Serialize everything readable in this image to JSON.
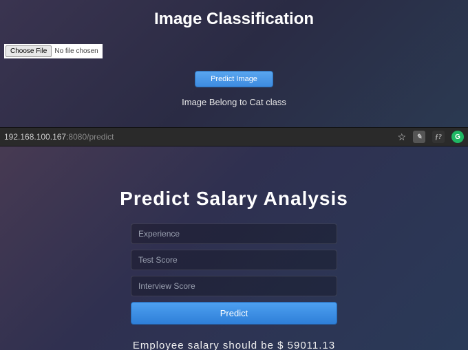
{
  "top": {
    "title": "Image Classification",
    "choose_file_label": "Choose File",
    "file_status": "No file chosen",
    "predict_button": "Predict Image",
    "result": "Image Belong to Cat class"
  },
  "urlbar": {
    "host": "192.168.100.167",
    "port_path": ":8080/predict"
  },
  "bottom": {
    "title": "Predict Salary Analysis",
    "placeholders": {
      "experience": "Experience",
      "test_score": "Test Score",
      "interview_score": "Interview Score"
    },
    "predict_button": "Predict",
    "result": "Employee salary should be $ 59011.13"
  }
}
